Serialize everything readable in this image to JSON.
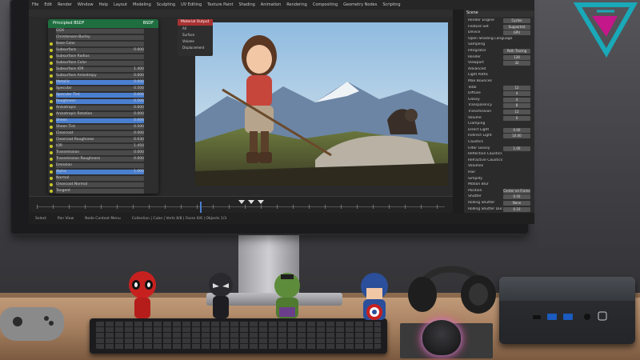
{
  "blender": {
    "menu": [
      "File",
      "Edit",
      "Render",
      "Window",
      "Help",
      "Layout",
      "Modeling",
      "Sculpting",
      "UV Editing",
      "Texture Paint",
      "Shading",
      "Animation",
      "Rendering",
      "Compositing",
      "Geometry Nodes",
      "Scripting"
    ],
    "node": {
      "title": "Principled BSDF",
      "output_label": "BSDF",
      "dropdown": "GGX",
      "dropdown2": "Christensen-Burley",
      "rows": [
        {
          "label": "Base Color",
          "value": ""
        },
        {
          "label": "Subsurface",
          "value": "0.000"
        },
        {
          "label": "Subsurface Radius",
          "value": ""
        },
        {
          "label": "Subsurface Color",
          "value": ""
        },
        {
          "label": "Subsurface IOR",
          "value": "1.400"
        },
        {
          "label": "Subsurface Anisotropy",
          "value": "0.000"
        },
        {
          "label": "Metallic",
          "value": "0.000"
        },
        {
          "label": "Specular",
          "value": "0.500"
        },
        {
          "label": "Specular Tint",
          "value": "0.000"
        },
        {
          "label": "Roughness",
          "value": "0.500"
        },
        {
          "label": "Anisotropic",
          "value": "0.000"
        },
        {
          "label": "Anisotropic Rotation",
          "value": "0.000"
        },
        {
          "label": "Sheen",
          "value": "0.000"
        },
        {
          "label": "Sheen Tint",
          "value": "0.500"
        },
        {
          "label": "Clearcoat",
          "value": "0.000"
        },
        {
          "label": "Clearcoat Roughness",
          "value": "0.030"
        },
        {
          "label": "IOR",
          "value": "1.450"
        },
        {
          "label": "Transmission",
          "value": "0.000"
        },
        {
          "label": "Transmission Roughness",
          "value": "0.000"
        },
        {
          "label": "Emission",
          "value": ""
        },
        {
          "label": "Alpha",
          "value": "1.000"
        },
        {
          "label": "Normal",
          "value": ""
        },
        {
          "label": "Clearcoat Normal",
          "value": ""
        },
        {
          "label": "Tangent",
          "value": ""
        }
      ]
    },
    "material_output": {
      "title": "Material Output",
      "rows": [
        "All",
        "Surface",
        "Volume",
        "Displacement"
      ]
    },
    "properties": {
      "header": "Scene",
      "rows": [
        {
          "label": "Render Engine",
          "value": "Cycles"
        },
        {
          "label": "Feature Set",
          "value": "Supported"
        },
        {
          "label": "Device",
          "value": "GPU"
        },
        {
          "label": "Open Shading Language",
          "value": ""
        },
        {
          "label": "Sampling",
          "value": ""
        },
        {
          "label": "Integrator",
          "value": "Path Tracing"
        },
        {
          "label": "Render",
          "value": "128"
        },
        {
          "label": "Viewport",
          "value": "32"
        },
        {
          "label": "Advanced",
          "value": ""
        },
        {
          "label": "Light Paths",
          "value": ""
        },
        {
          "label": "Max Bounces",
          "value": ""
        },
        {
          "label": "Total",
          "value": "12"
        },
        {
          "label": "Diffuse",
          "value": "4"
        },
        {
          "label": "Glossy",
          "value": "4"
        },
        {
          "label": "Transparency",
          "value": "8"
        },
        {
          "label": "Transmission",
          "value": "12"
        },
        {
          "label": "Volume",
          "value": "0"
        },
        {
          "label": "Clamping",
          "value": ""
        },
        {
          "label": "Direct Light",
          "value": "0.00"
        },
        {
          "label": "Indirect Light",
          "value": "10.00"
        },
        {
          "label": "Caustics",
          "value": ""
        },
        {
          "label": "Filter Glossy",
          "value": "1.00"
        },
        {
          "label": "Reflective Caustics",
          "value": ""
        },
        {
          "label": "Refractive Caustics",
          "value": ""
        },
        {
          "label": "Volumes",
          "value": ""
        },
        {
          "label": "Hair",
          "value": ""
        },
        {
          "label": "Simplify",
          "value": ""
        },
        {
          "label": "Motion Blur",
          "value": ""
        },
        {
          "label": "Position",
          "value": "Center on Frame"
        },
        {
          "label": "Shutter",
          "value": "0.50"
        },
        {
          "label": "Rolling Shutter",
          "value": "None"
        },
        {
          "label": "Rolling Shutter Dur.",
          "value": "0.10"
        }
      ]
    },
    "status": [
      "Select",
      "Pan View",
      "Node Context Menu",
      "Collection | Cube | Verts 8/8 | Faces 6/6 | Objects 1/3"
    ]
  },
  "colors": {
    "node_header": "#1f6e3f",
    "material_header": "#a83232",
    "selection_blue": "#4a7fd0",
    "watermark_teal": "#1aa9b8",
    "watermark_magenta": "#c3178a"
  },
  "icons": [
    "gamepad-icon",
    "keyboard-icon",
    "mouse-icon",
    "headphones-icon",
    "mini-pc-icon",
    "logo-watermark"
  ]
}
